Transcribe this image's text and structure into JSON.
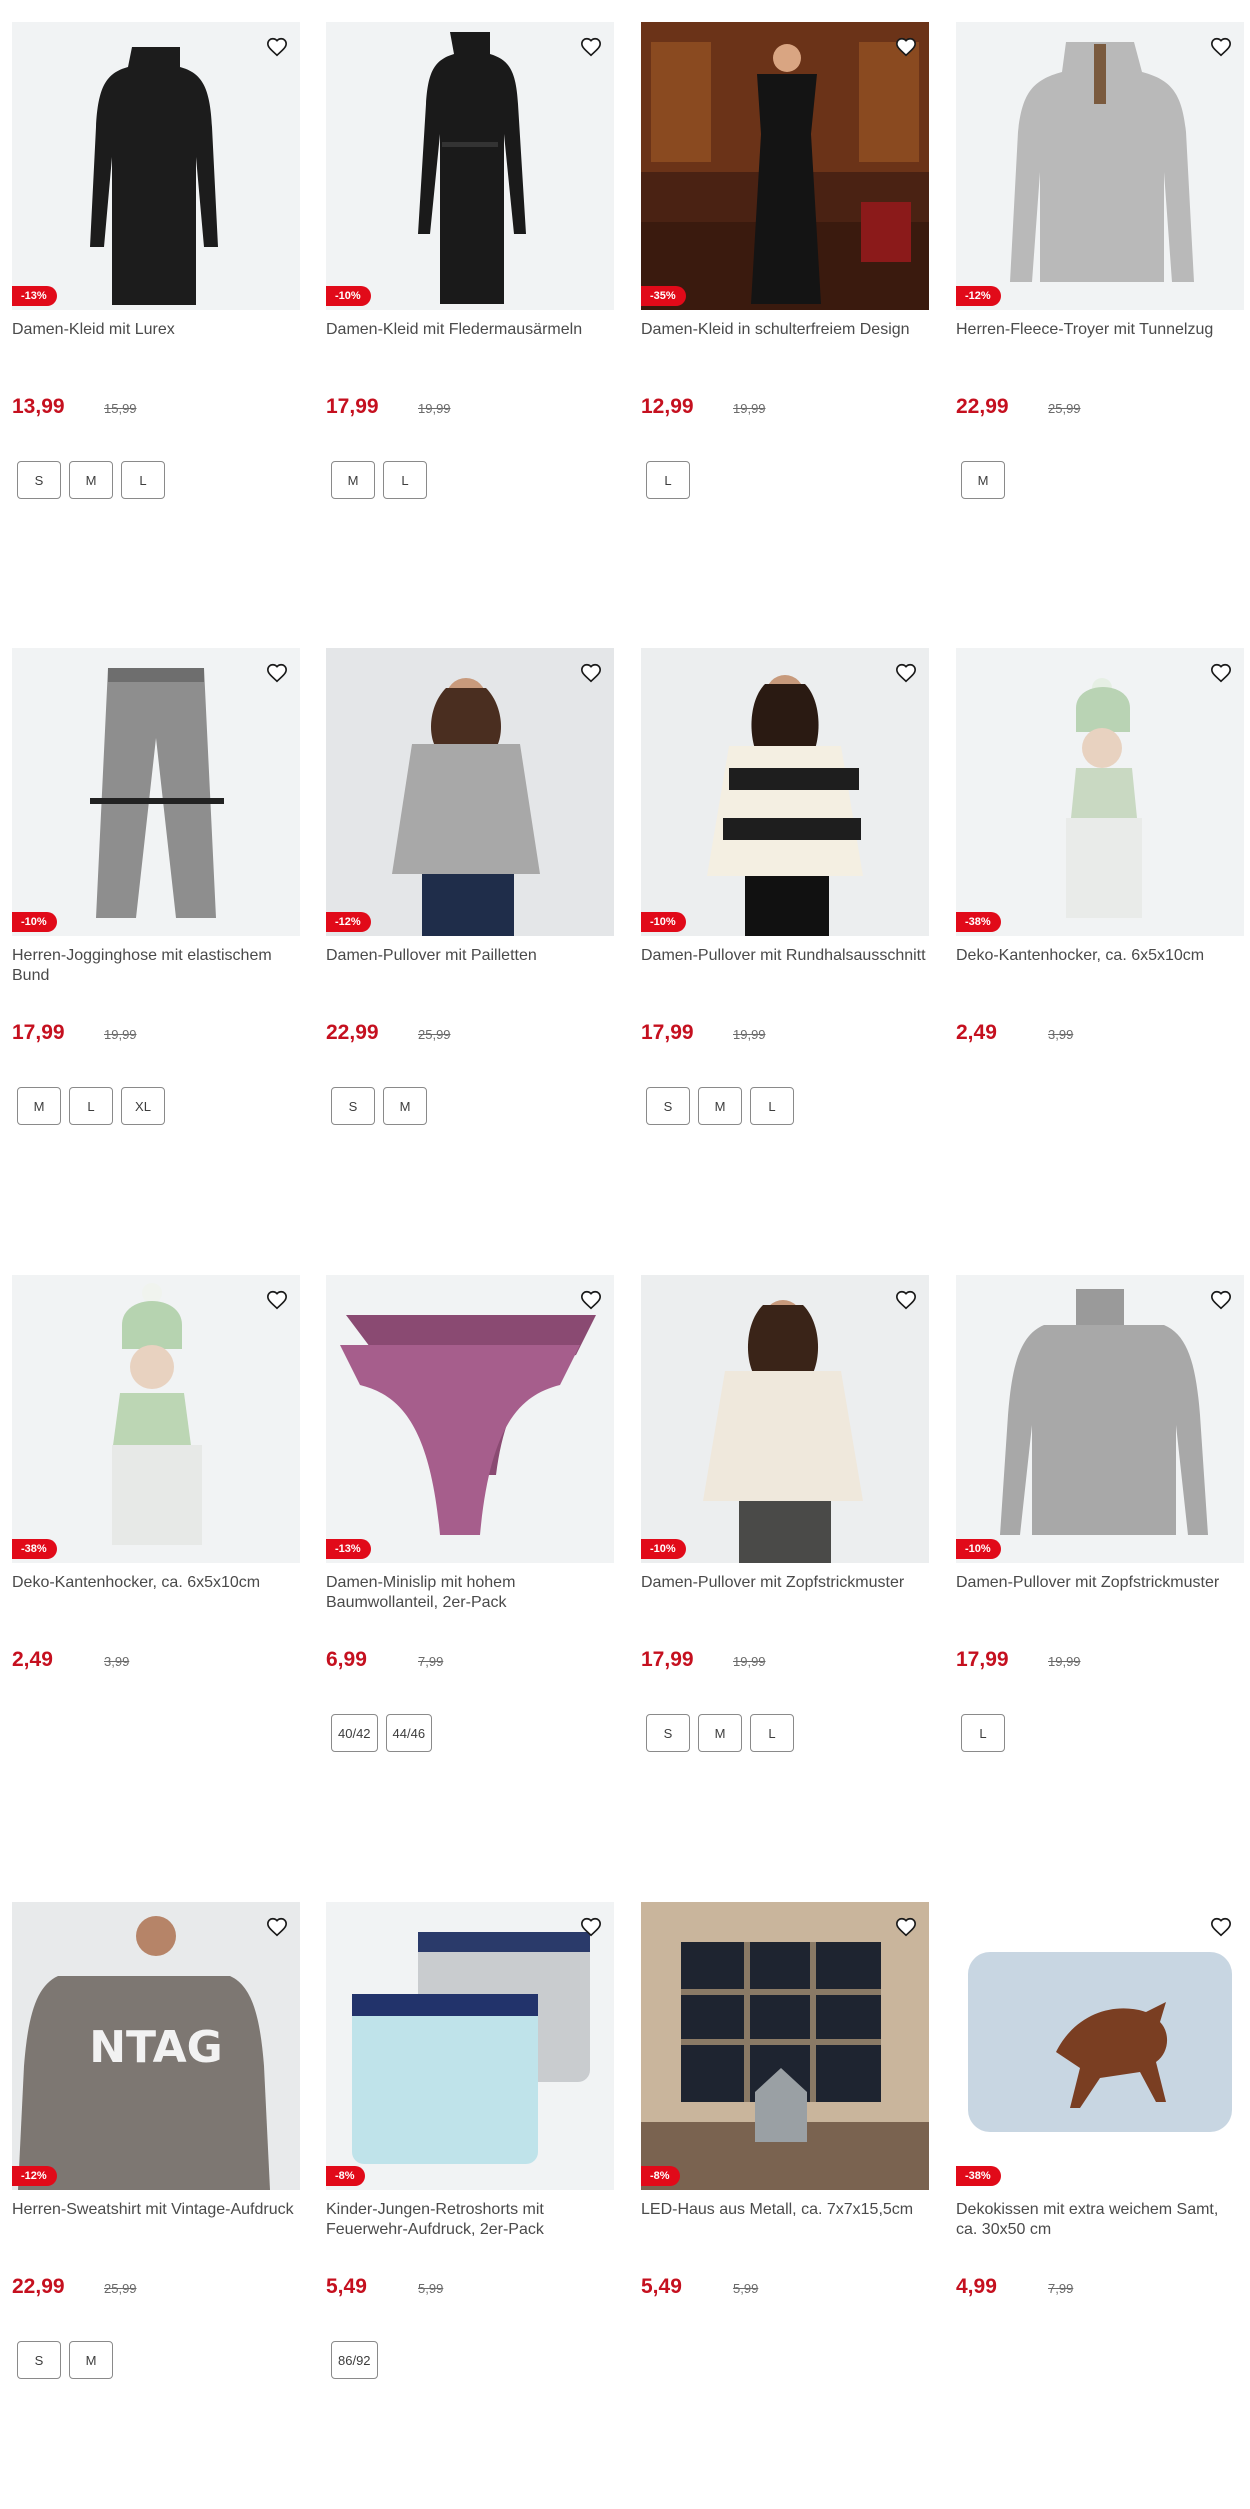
{
  "products": [
    {
      "title": "Damen-Kleid mit Lurex",
      "badge": "-13%",
      "price": "13,99",
      "old_price": "15,99",
      "sizes": [
        "S",
        "M",
        "L"
      ]
    },
    {
      "title": "Damen-Kleid mit Fledermausärmeln",
      "badge": "-10%",
      "price": "17,99",
      "old_price": "19,99",
      "sizes": [
        "M",
        "L"
      ]
    },
    {
      "title": "Damen-Kleid in schulterfreiem Design",
      "badge": "-35%",
      "price": "12,99",
      "old_price": "19,99",
      "sizes": [
        "L"
      ]
    },
    {
      "title": "Herren-Fleece-Troyer mit Tunnelzug",
      "badge": "-12%",
      "price": "22,99",
      "old_price": "25,99",
      "sizes": [
        "M"
      ]
    },
    {
      "title": "Herren-Jogginghose mit elastischem Bund",
      "badge": "-10%",
      "price": "17,99",
      "old_price": "19,99",
      "sizes": [
        "M",
        "L",
        "XL"
      ]
    },
    {
      "title": "Damen-Pullover mit Pailletten",
      "badge": "-12%",
      "price": "22,99",
      "old_price": "25,99",
      "sizes": [
        "S",
        "M"
      ]
    },
    {
      "title": "Damen-Pullover mit Rundhalsausschnitt",
      "badge": "-10%",
      "price": "17,99",
      "old_price": "19,99",
      "sizes": [
        "S",
        "M",
        "L"
      ]
    },
    {
      "title": "Deko-Kantenhocker, ca. 6x5x10cm",
      "badge": "-38%",
      "price": "2,49",
      "old_price": "3,99",
      "sizes": []
    },
    {
      "title": "Deko-Kantenhocker, ca. 6x5x10cm",
      "badge": "-38%",
      "price": "2,49",
      "old_price": "3,99",
      "sizes": []
    },
    {
      "title": "Damen-Minislip mit hohem Baumwollanteil, 2er-Pack",
      "badge": "-13%",
      "price": "6,99",
      "old_price": "7,99",
      "sizes": [
        "40/42",
        "44/46"
      ]
    },
    {
      "title": "Damen-Pullover mit Zopfstrickmuster",
      "badge": "-10%",
      "price": "17,99",
      "old_price": "19,99",
      "sizes": [
        "S",
        "M",
        "L"
      ]
    },
    {
      "title": "Damen-Pullover mit Zopfstrickmuster",
      "badge": "-10%",
      "price": "17,99",
      "old_price": "19,99",
      "sizes": [
        "L"
      ]
    },
    {
      "title": "Herren-Sweatshirt mit Vintage-Aufdruck",
      "badge": "-12%",
      "price": "22,99",
      "old_price": "25,99",
      "sizes": [
        "S",
        "M"
      ]
    },
    {
      "title": "Kinder-Jungen-Retroshorts mit Feuerwehr-Aufdruck, 2er-Pack",
      "badge": "-8%",
      "price": "5,49",
      "old_price": "5,99",
      "sizes": [
        "86/92"
      ]
    },
    {
      "title": "LED-Haus aus Metall, ca. 7x7x15,5cm",
      "badge": "-8%",
      "price": "5,49",
      "old_price": "5,99",
      "sizes": []
    },
    {
      "title": "Dekokissen mit extra weichem Samt, ca. 30x50 cm",
      "badge": "-38%",
      "price": "4,99",
      "old_price": "7,99",
      "sizes": []
    }
  ],
  "colors": {
    "accent": "#c5101f",
    "badge": "#e10a19"
  },
  "icons": {
    "favorite": "heart-outline-icon"
  }
}
